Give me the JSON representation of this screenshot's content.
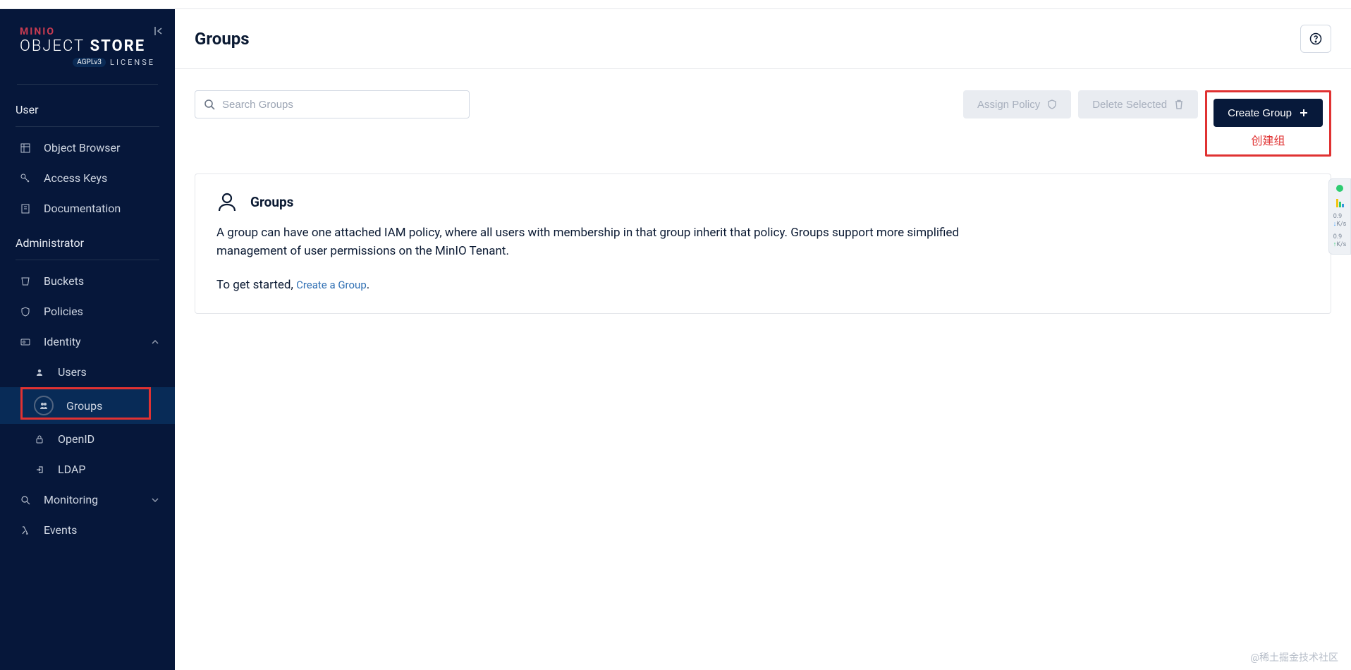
{
  "logo": {
    "brand": "MINIO",
    "line1_thin": "OBJECT",
    "line1_bold": " STORE",
    "license_label": "LICENSE",
    "agpl": "AGPLv3"
  },
  "sidebar": {
    "sections": {
      "user": {
        "title": "User"
      },
      "admin": {
        "title": "Administrator"
      }
    },
    "items": {
      "object_browser": "Object Browser",
      "access_keys": "Access Keys",
      "documentation": "Documentation",
      "buckets": "Buckets",
      "policies": "Policies",
      "identity": "Identity",
      "users": "Users",
      "groups": "Groups",
      "openid": "OpenID",
      "ldap": "LDAP",
      "monitoring": "Monitoring",
      "events": "Events"
    }
  },
  "header": {
    "title": "Groups"
  },
  "toolbar": {
    "search_placeholder": "Search Groups",
    "assign_policy": "Assign Policy",
    "delete_selected": "Delete Selected",
    "create_group": "Create Group",
    "create_group_annotation": "创建组"
  },
  "empty": {
    "heading": "Groups",
    "description": "A group can have one attached IAM policy, where all users with membership in that group inherit that policy. Groups support more simplified management of user permissions on the MinIO Tenant.",
    "cta_prefix": "To get started, ",
    "cta_link": "Create a Group",
    "cta_suffix": "."
  },
  "perf": {
    "v1": "0.9",
    "u1": "K/s",
    "v2": "0.9",
    "u2": "K/s"
  },
  "watermark": "@稀土掘金技术社区"
}
